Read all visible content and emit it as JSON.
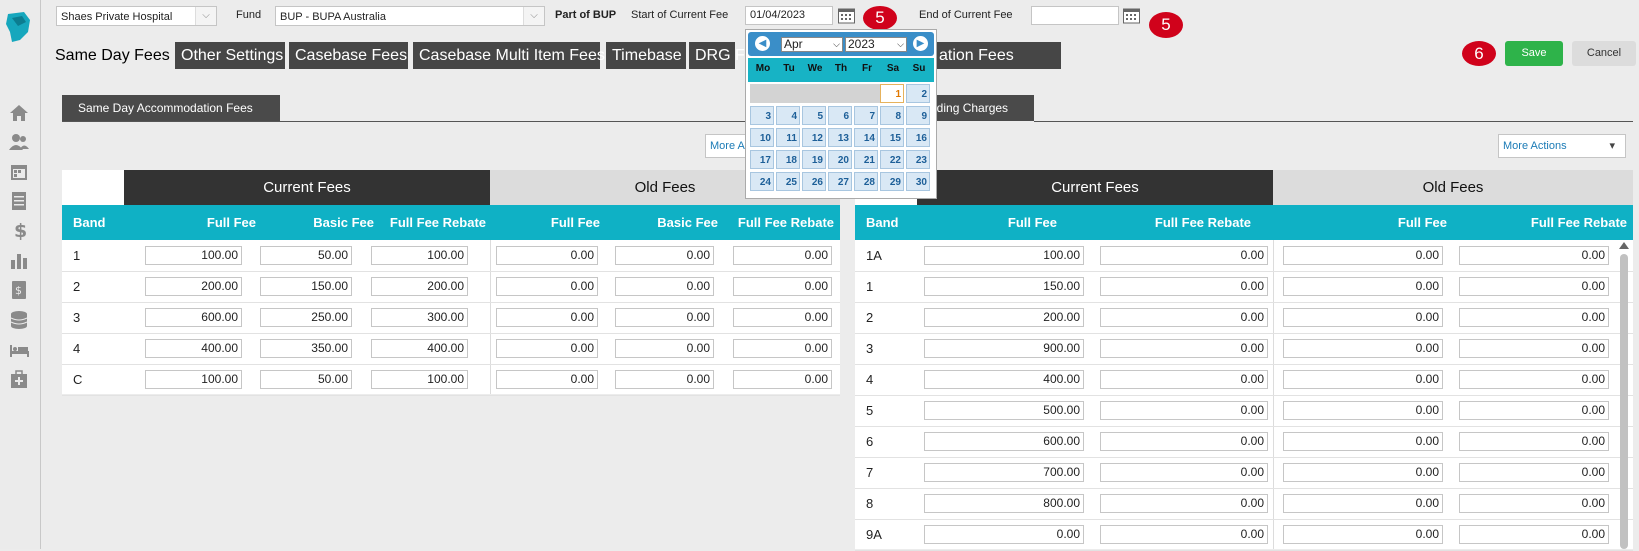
{
  "header": {
    "hospital": "Shaes Private Hospital",
    "fund_label": "Fund",
    "fund_value": "BUP - BUPA Australia",
    "part_of": "Part of BUP",
    "start_label": "Start of Current Fee",
    "start_value": "01/04/2023",
    "end_label": "End of Current Fee",
    "end_value": "",
    "badge_start": "5",
    "badge_end": "5",
    "badge_save": "6"
  },
  "tabs": [
    "Same Day Fees",
    "Other Settings",
    "Casebase Fees",
    "Casebase Multi Item Fees",
    "Timebase",
    "DRG F",
    "ation Fees"
  ],
  "buttons": {
    "save": "Save",
    "cancel": "Cancel"
  },
  "subtabs": {
    "left": "Same Day Accommodation Fees",
    "right": "nding Charges"
  },
  "more_actions": {
    "left": "More A",
    "right": "More Actions"
  },
  "calendar": {
    "month": "Apr",
    "year": "2023",
    "weekdays": [
      "Mo",
      "Tu",
      "We",
      "Th",
      "Fr",
      "Sa",
      "Su"
    ],
    "weeks": [
      [
        "",
        "",
        "",
        "",
        "",
        "1",
        "2"
      ],
      [
        "3",
        "4",
        "5",
        "6",
        "7",
        "8",
        "9"
      ],
      [
        "10",
        "11",
        "12",
        "13",
        "14",
        "15",
        "16"
      ],
      [
        "17",
        "18",
        "19",
        "20",
        "21",
        "22",
        "23"
      ],
      [
        "24",
        "25",
        "26",
        "27",
        "28",
        "29",
        "30"
      ]
    ],
    "today": "1"
  },
  "left_table": {
    "current_title": "Current Fees",
    "old_title": "Old Fees",
    "columns": [
      "Band",
      "Full Fee",
      "Basic Fee",
      "Full Fee Rebate",
      "Full Fee",
      "Basic Fee",
      "Full Fee Rebate"
    ],
    "rows": [
      [
        "1",
        "100.00",
        "50.00",
        "100.00",
        "0.00",
        "0.00",
        "0.00"
      ],
      [
        "2",
        "200.00",
        "150.00",
        "200.00",
        "0.00",
        "0.00",
        "0.00"
      ],
      [
        "3",
        "600.00",
        "250.00",
        "300.00",
        "0.00",
        "0.00",
        "0.00"
      ],
      [
        "4",
        "400.00",
        "350.00",
        "400.00",
        "0.00",
        "0.00",
        "0.00"
      ],
      [
        "C",
        "100.00",
        "50.00",
        "100.00",
        "0.00",
        "0.00",
        "0.00"
      ]
    ]
  },
  "right_table": {
    "current_title": "Current Fees",
    "old_title": "Old Fees",
    "columns": [
      "Band",
      "Full Fee",
      "Full Fee Rebate",
      "Full Fee",
      "Full Fee Rebate"
    ],
    "rows": [
      [
        "1A",
        "100.00",
        "0.00",
        "0.00",
        "0.00"
      ],
      [
        "1",
        "150.00",
        "0.00",
        "0.00",
        "0.00"
      ],
      [
        "2",
        "200.00",
        "0.00",
        "0.00",
        "0.00"
      ],
      [
        "3",
        "900.00",
        "0.00",
        "0.00",
        "0.00"
      ],
      [
        "4",
        "400.00",
        "0.00",
        "0.00",
        "0.00"
      ],
      [
        "5",
        "500.00",
        "0.00",
        "0.00",
        "0.00"
      ],
      [
        "6",
        "600.00",
        "0.00",
        "0.00",
        "0.00"
      ],
      [
        "7",
        "700.00",
        "0.00",
        "0.00",
        "0.00"
      ],
      [
        "8",
        "800.00",
        "0.00",
        "0.00",
        "0.00"
      ],
      [
        "9A",
        "0.00",
        "0.00",
        "0.00",
        "0.00"
      ]
    ]
  },
  "colors": {
    "accent": "#0fb1c5",
    "save": "#2eb34a",
    "badge": "#d0021b",
    "dark": "#333333"
  }
}
